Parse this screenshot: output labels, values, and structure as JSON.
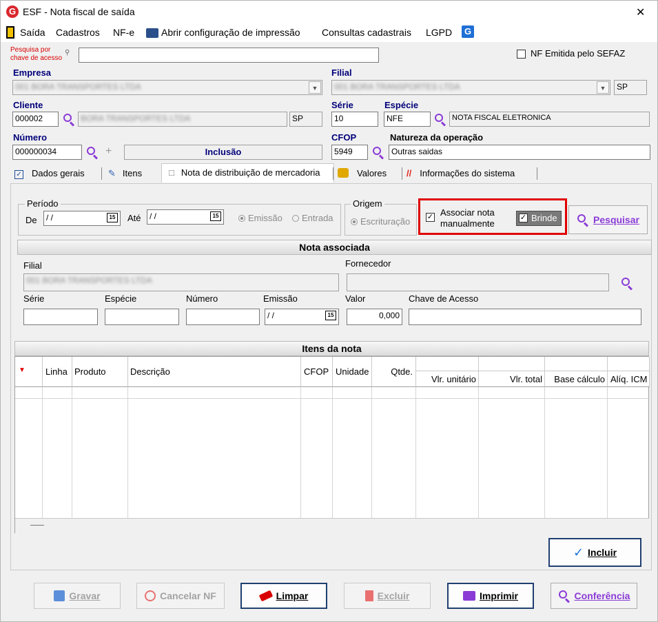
{
  "window": {
    "title": "ESF - Nota fiscal de saída",
    "close": "✕"
  },
  "menu": {
    "items": [
      "Saída",
      "Cadastros",
      "NF-e",
      "Abrir configuração de impressão",
      "Consultas cadastrais",
      "LGPD"
    ]
  },
  "search": {
    "label_line1": "Pesquisa por",
    "label_line2": "chave de acesso",
    "value": "",
    "sefaz_label": "NF Emitida pelo SEFAZ",
    "sefaz_checked": false
  },
  "empresa": {
    "label": "Empresa",
    "value": "001 BORA TRANSPORTES LTDA"
  },
  "filial": {
    "label": "Filial",
    "value": "001 BORA TRANSPORTES LTDA",
    "uf": "SP"
  },
  "cliente": {
    "label": "Cliente",
    "code": "000002",
    "name": "BORA TRANSPORTES LTDA",
    "uf": "SP"
  },
  "serie": {
    "label": "Série",
    "value": "10"
  },
  "especie": {
    "label": "Espécie",
    "code": "NFE",
    "name": "NOTA FISCAL ELETRONICA"
  },
  "numero": {
    "label": "Número",
    "value": "000000034",
    "mode": "Inclusão"
  },
  "cfop": {
    "label": "CFOP",
    "value": "5949"
  },
  "natureza": {
    "label": "Natureza da operação",
    "value": "Outras saidas"
  },
  "tabs": [
    "Dados gerais",
    "Itens",
    "Nota de distribuição de mercadoria",
    "Valores",
    "Informações do sistema"
  ],
  "active_tab": "Nota de distribuição de mercadoria",
  "periodo": {
    "title": "Período",
    "de_label": "De",
    "de_value": " / /",
    "ate_label": "Até",
    "ate_value": " / /",
    "cal": "15",
    "opt_emissao": "Emissão",
    "opt_entrada": "Entrada"
  },
  "origem": {
    "title": "Origem",
    "opt_escrituracao": "Escrituração"
  },
  "associar": {
    "label_line1": "Associar nota",
    "label_line2": "manualmente",
    "checked": true
  },
  "brinde": {
    "label": "Brinde",
    "checked": true
  },
  "pesquisar_button": "Pesquisar",
  "nota_associada": {
    "title": "Nota associada",
    "filial_label": "Filial",
    "filial_value": "001 BORA TRANSPORTES LTDA",
    "fornecedor_label": "Fornecedor",
    "fornecedor_value": "",
    "serie_label": "Série",
    "especie_label": "Espécie",
    "numero_label": "Número",
    "emissao_label": "Emissão",
    "emissao_value": " / /",
    "valor_label": "Valor",
    "valor_value": "0,000",
    "chave_label": "Chave de Acesso"
  },
  "itens_nota": {
    "title": "Itens da nota",
    "columns": [
      "Linha",
      "Produto",
      "Descrição",
      "CFOP",
      "Unidade",
      "Qtde.",
      "Vlr. unitário",
      "Vlr. total",
      "Base cálculo",
      "Alíq. ICM"
    ]
  },
  "incluir_button": "Incluir",
  "footer": {
    "gravar": "Gravar",
    "cancelar": "Cancelar NF",
    "limpar": "Limpar",
    "excluir": "Excluir",
    "imprimir": "Imprimir",
    "conferencia": "Conferência"
  },
  "colors": {
    "label_blue": "#00007a",
    "accent_purple": "#8a3bd6",
    "highlight_red": "#e00000",
    "focus_border": "#1f3f70"
  }
}
